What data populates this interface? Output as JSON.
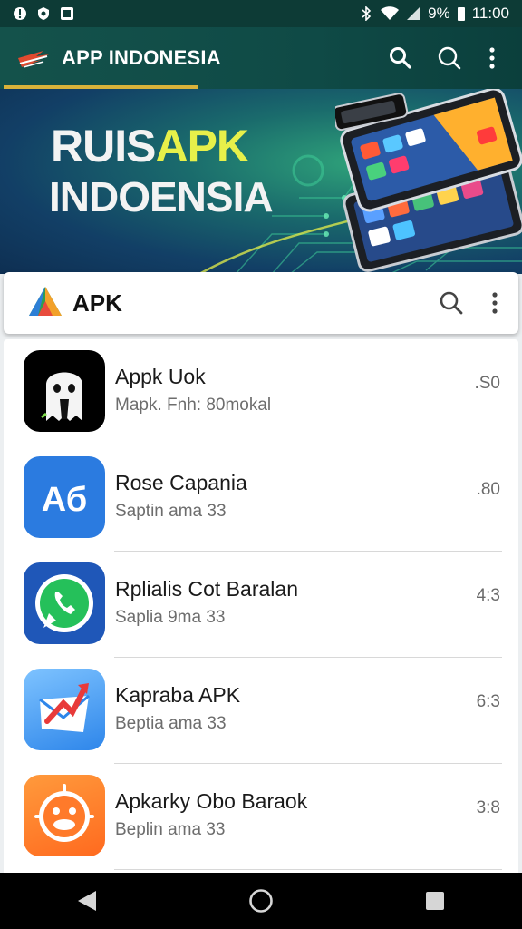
{
  "status_bar": {
    "battery": "9%",
    "time": "11:00",
    "left_icons": [
      "notification-icon",
      "shield-icon",
      "image-icon"
    ],
    "right_icons": [
      "bluetooth-icon",
      "wifi-icon",
      "signal-icon",
      "battery-icon"
    ]
  },
  "app_bar": {
    "title": "APP INDONESIA",
    "actions": [
      "search-icon",
      "search-icon",
      "more-vert-icon"
    ],
    "accent": "#d9b23a"
  },
  "hero": {
    "line1_a": "RUIS",
    "line1_b": "APK",
    "line2": "INDOENSIA"
  },
  "search_card": {
    "label": "APK",
    "actions": [
      "search-icon",
      "more-vert-icon"
    ]
  },
  "apps": [
    {
      "name": "Appk Uok",
      "sub": "Mapk. Fnh: 80mokal",
      "value": ".S0",
      "icon": "ghost-icon"
    },
    {
      "name": "Rose Capania",
      "sub": "Saptin ama 33",
      "value": ".80",
      "icon": "ab-text-icon"
    },
    {
      "name": "Rplialis Cot Baralan",
      "sub": "Saplia 9ma 33",
      "value": "4:3",
      "icon": "whatsapp-icon"
    },
    {
      "name": "Kapraba APK",
      "sub": "Beptia ama 33",
      "value": "6:3",
      "icon": "mail-arrow-icon"
    },
    {
      "name": "Apkarky Obo Baraok",
      "sub": "Beplin ama 33",
      "value": "3:8",
      "icon": "duck-face-icon"
    }
  ],
  "nav_bar": [
    "back-icon",
    "home-icon",
    "recents-icon"
  ]
}
